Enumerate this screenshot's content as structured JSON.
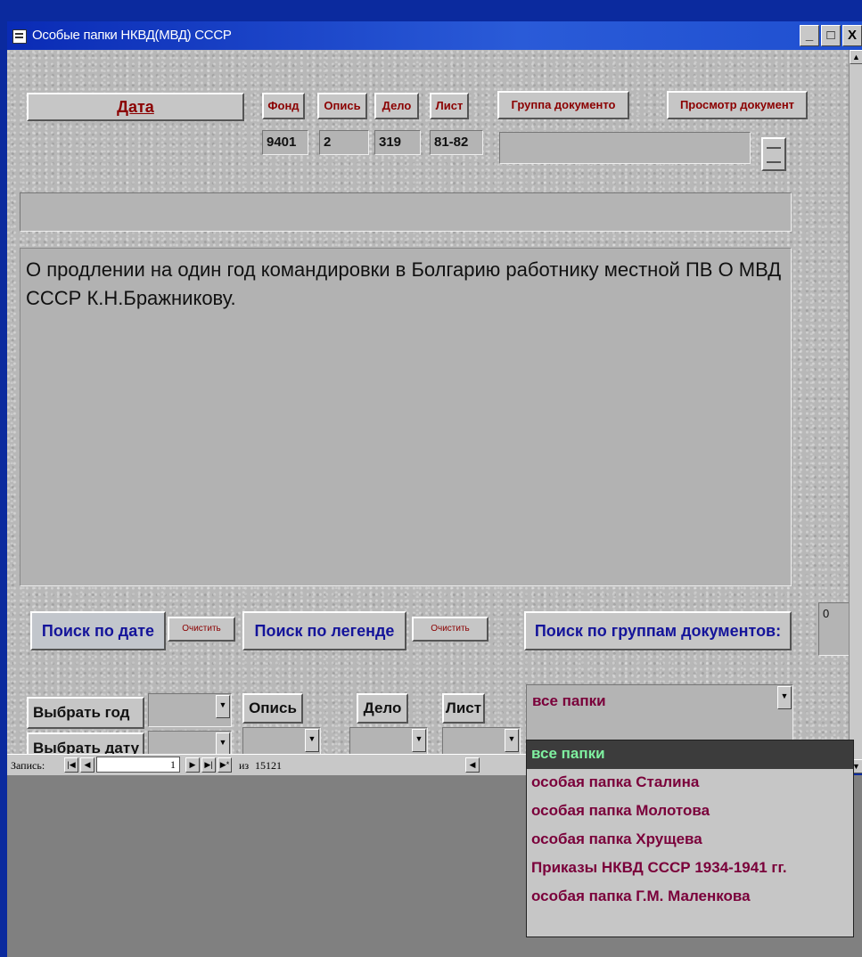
{
  "window": {
    "title": "Особые папки НКВД(МВД) СССР",
    "controls": [
      "_",
      "□",
      "X"
    ]
  },
  "header": {
    "date_button": "Дата",
    "fond_label": "Фонд",
    "opis_label": "Опись",
    "delo_label": "Дело",
    "list_label": "Лист",
    "group_button": "Группа документо",
    "view_button": "Просмотр документ",
    "fond_value": "9401",
    "opis_value": "2",
    "delo_value": "319",
    "list_value": "81-82"
  },
  "memo": {
    "text": "О продлении на один год командировки в Болгарию работнику местной ПВ О МВД СССР К.Н.Бражникову."
  },
  "search": {
    "by_date": "Поиск по дате",
    "clear1": "Очистить",
    "by_legend": "Поиск по легенде",
    "clear2": "Очистить",
    "by_groups": "Поиск по группам документов:",
    "counter": "0",
    "choose_year": "Выбрать год",
    "choose_date": "Выбрать дату",
    "opis": "Опись",
    "delo": "Дело",
    "list": "Лист",
    "group_value": "все папки"
  },
  "navigation": {
    "label": "Запись:",
    "current": "1",
    "of_label": "из",
    "total": "15121"
  },
  "dropdown": {
    "options": [
      "все папки",
      "особая папка Сталина",
      "особая папка Молотова",
      "особая папка Хрущева",
      "Приказы НКВД СССР 1934-1941 гг.",
      "особая папка Г.М. Маленкова"
    ]
  }
}
